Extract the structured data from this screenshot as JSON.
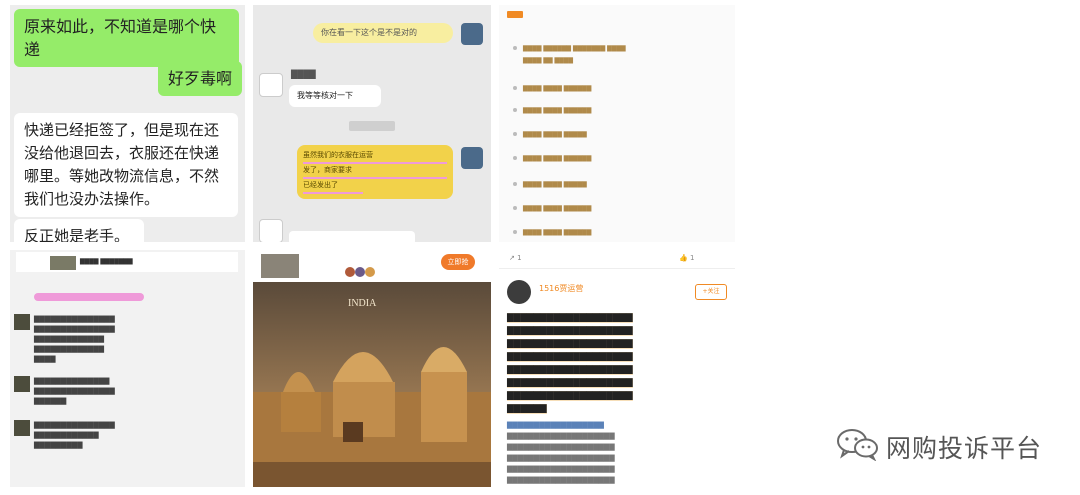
{
  "panel1": {
    "msg1": "原来如此，不知道是哪个快递",
    "msg2": "好歹毒啊",
    "msg3": "快递已经拒签了，但是现在还没给他退回去，衣服还在快递哪里。等她改物流信息，不然我们也没办法操作。",
    "msg4": "反正她是老手。"
  },
  "panel2": {
    "msg1": "你在看一下这个是不是对的",
    "msg2": "我等等核对一下",
    "msg3_line1": "虽然我们的衣服在运营",
    "msg3_line2": "发了，商家要求",
    "msg3_line3": "已经发出了"
  },
  "panel6": {
    "likes": "1",
    "shares": "1",
    "user": "1516贾运营",
    "follow": "+关注"
  },
  "panel5": {
    "image_word": "INDIA",
    "header_button": "立即抢"
  },
  "logo": {
    "text": "网购投诉平台",
    "icon": "wechat-icon"
  },
  "colors": {
    "chat_green": "#95ec69",
    "chat_bg": "#ededed",
    "highlight_yellow": "#f7d046",
    "highlight_pink": "#ef9ad9",
    "weibo_orange": "#f08a24",
    "link_blue": "#5b82b8"
  }
}
